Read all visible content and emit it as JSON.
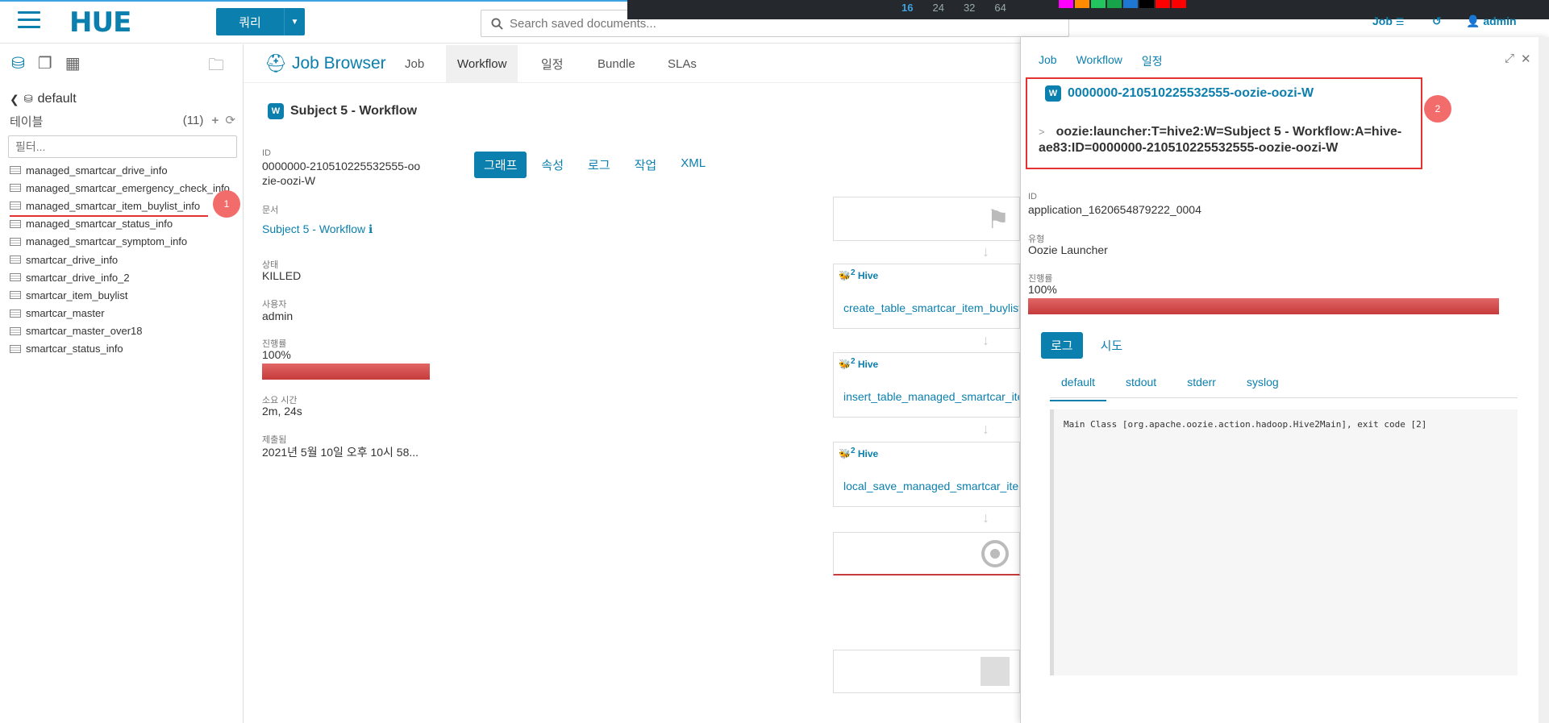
{
  "topbar": {
    "logo": "HUE",
    "query_button": "쿼리",
    "search_placeholder": "Search saved documents...",
    "dark_numbers": [
      "16",
      "24",
      "32",
      "64"
    ],
    "swatch_colors": [
      "#ff00ff",
      "#ff8c00",
      "#22c55e",
      "#16a34a",
      "#1f77d4",
      "#000000",
      "#ff0000",
      "#ff0000"
    ],
    "job_link": "Job",
    "user": "admin"
  },
  "left": {
    "database": "default",
    "tables_label": "테이블",
    "tables_count": "(11)",
    "filter_placeholder": "필터...",
    "tables": [
      "managed_smartcar_drive_info",
      "managed_smartcar_emergency_check_info",
      "managed_smartcar_item_buylist_info",
      "managed_smartcar_status_info",
      "managed_smartcar_symptom_info",
      "smartcar_drive_info",
      "smartcar_drive_info_2",
      "smartcar_item_buylist",
      "smartcar_master",
      "smartcar_master_over18",
      "smartcar_status_info"
    ],
    "annotation": "1"
  },
  "job_browser": {
    "title": "Job Browser",
    "tabs": [
      "Job",
      "Workflow",
      "일정",
      "Bundle",
      "SLAs"
    ],
    "active_tab": "Workflow"
  },
  "workflow": {
    "title": "Subject 5 - Workflow",
    "icon_letter": "W",
    "id_label": "ID",
    "id_line1": "0000000-210510225532555-oo",
    "id_line2": "zie-oozi-W",
    "doc_label": "문서",
    "doc_value": "Subject 5 - Workflow",
    "doc_info_icon": "ℹ",
    "status_label": "상태",
    "status_value": "KILLED",
    "user_label": "사용자",
    "user_value": "admin",
    "progress_label": "진행률",
    "progress_value": "100%",
    "progress_fraction": 1.0,
    "duration_label": "소요 시간",
    "duration_value": "2m, 24s",
    "submitted_label": "제출됨",
    "submitted_value": "2021년 5월 10일 오후 10시 58...",
    "view_tabs": [
      "그래프",
      "속성",
      "로그",
      "작업",
      "XML"
    ],
    "active_view_tab": "그래프",
    "nodes": [
      {
        "type": "Hive",
        "superscript": "2",
        "name": "create_table_smartcar_item_buylist"
      },
      {
        "type": "Hive",
        "superscript": "2",
        "name": "insert_table_managed_smartcar_item"
      },
      {
        "type": "Hive",
        "superscript": "2",
        "name": "local_save_managed_smartcar_item"
      }
    ]
  },
  "popover": {
    "tabs": [
      "Job",
      "Workflow",
      "일정"
    ],
    "job_id": "0000000-210510225532555-oozie-oozi-W",
    "gt": ">",
    "job_name": "oozie:launcher:T=hive2:W=Subject 5 - Workflow:A=hive-ae83:ID=0000000-210510225532555-oozie-oozi-W",
    "annotation": "2",
    "id_label": "ID",
    "id_value": "application_1620654879222_0004",
    "type_label": "유형",
    "type_value": "Oozie Launcher",
    "progress_label": "진행률",
    "progress_value": "100%",
    "progress_fraction": 1.0,
    "log_tabs": [
      "로그",
      "시도"
    ],
    "active_log_tab": "로그",
    "log_sub_tabs": [
      "default",
      "stdout",
      "stderr",
      "syslog"
    ],
    "active_log_sub_tab": "default",
    "log_text": "Main Class [org.apache.oozie.action.hadoop.Hive2Main], exit code [2]"
  }
}
